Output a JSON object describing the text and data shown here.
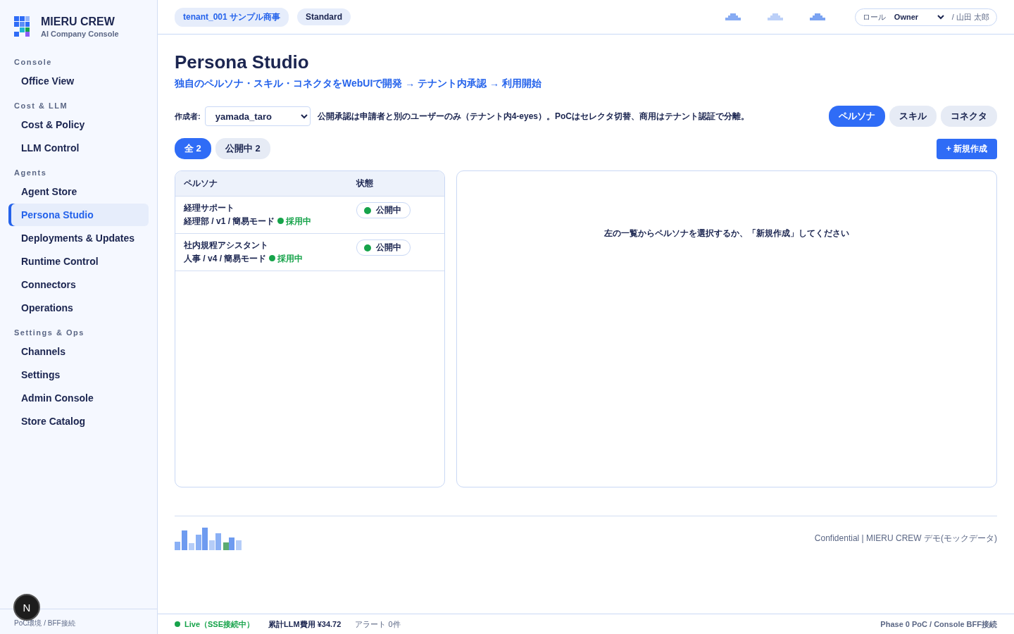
{
  "sidebar": {
    "brand": {
      "title": "MIERU CREW",
      "subtitle": "AI Company Console"
    },
    "sections": [
      {
        "heading": "Console",
        "items": [
          {
            "label": "Office View",
            "selected": false
          }
        ]
      },
      {
        "heading": "Cost & LLM",
        "items": [
          {
            "label": "Cost & Policy",
            "selected": false
          },
          {
            "label": "LLM Control",
            "selected": false
          }
        ]
      },
      {
        "heading": "Agents",
        "items": [
          {
            "label": "Agent Store",
            "selected": false
          },
          {
            "label": "Persona Studio",
            "selected": true
          },
          {
            "label": "Deployments & Updates",
            "selected": false
          },
          {
            "label": "Runtime Control",
            "selected": false
          },
          {
            "label": "Connectors",
            "selected": false
          },
          {
            "label": "Operations",
            "selected": false
          }
        ]
      },
      {
        "heading": "Settings & Ops",
        "items": [
          {
            "label": "Channels",
            "selected": false
          },
          {
            "label": "Settings",
            "selected": false
          },
          {
            "label": "Admin Console",
            "selected": false
          },
          {
            "label": "Store Catalog",
            "selected": false
          }
        ]
      }
    ],
    "footer": "PoC環境 / BFF接続",
    "dev_badge": "N"
  },
  "topbar": {
    "tenant": "tenant_001 サンプル商事",
    "plan": "Standard",
    "role_label": "ロール",
    "role": "Owner",
    "user": "/ 山田 太郎"
  },
  "page": {
    "title": "Persona Studio",
    "subtitle": "独自のペルソナ・スキル・コネクタをWebUIで開発 → テナント内承認 → 利用開始",
    "author_label": "作成者:",
    "author": "yamada_taro",
    "note": "公開承認は申請者と別のユーザーのみ（テナント内4-eyes）。PoCはセレクタ切替、商用はテナント認証で分離。",
    "type_tabs": [
      {
        "label": "ペルソナ",
        "selected": true
      },
      {
        "label": "スキル",
        "selected": false
      },
      {
        "label": "コネクタ",
        "selected": false
      }
    ],
    "filters": [
      {
        "label": "全 2",
        "selected": true
      },
      {
        "label": "公開中 2",
        "selected": false
      }
    ],
    "new_button": "+ 新規作成"
  },
  "table": {
    "columns": [
      "ペルソナ",
      "状態"
    ],
    "rows": [
      {
        "name": "経理サポート",
        "meta": "経理部 / v1 / 簡易モード",
        "adoption": "採用中",
        "status": "公開中"
      },
      {
        "name": "社内規程アシスタント",
        "meta": "人事 / v4 / 簡易モード",
        "adoption": "採用中",
        "status": "公開中"
      }
    ]
  },
  "detail": {
    "empty_message": "左の一覧からペルソナを選択するか、「新規作成」してください"
  },
  "footer": {
    "confidential": "Confidential | MIERU CREW デモ(モックデータ)"
  },
  "status_bar": {
    "live": "Live（SSE接続中）",
    "cost": "累計LLM費用 ¥34.72",
    "alerts": "アラート 0件",
    "phase": "Phase 0 PoC / Console BFF接続"
  }
}
